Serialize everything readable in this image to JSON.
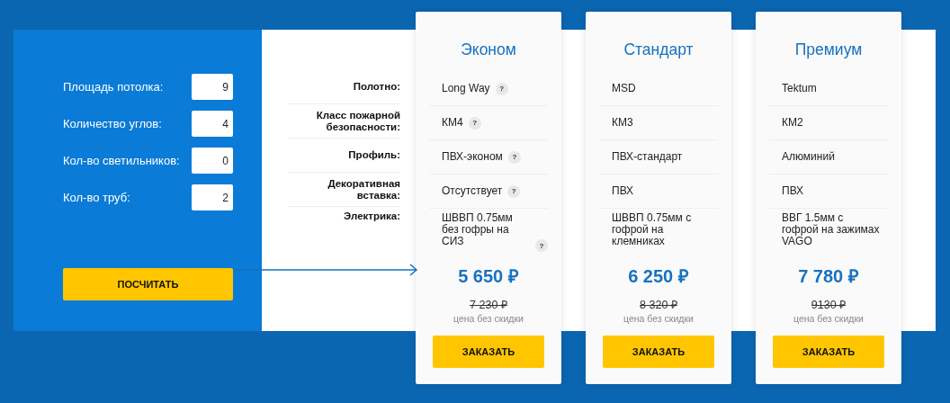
{
  "calculator": {
    "fields": [
      {
        "label": "Площадь потолка:",
        "value": "9"
      },
      {
        "label": "Количество углов:",
        "value": "4"
      },
      {
        "label": "Кол-во светильников:",
        "value": "0"
      },
      {
        "label": "Кол-во труб:",
        "value": "2"
      }
    ],
    "button": "ПОСЧИТАТЬ"
  },
  "comparison": {
    "row_labels": [
      "Полотно:",
      "Класс пожарной безопасности:",
      "Профиль:",
      "Декоративная вставка:",
      "Электрика:"
    ],
    "plans": [
      {
        "name": "Эконом",
        "features": [
          {
            "text": "Long Way",
            "help": "?"
          },
          {
            "text": "КМ4",
            "help": "?"
          },
          {
            "text": "ПВХ-эконом",
            "help": "?"
          },
          {
            "text": "Отсутствует",
            "help": "?"
          },
          {
            "text": "ШВВП 0.75мм без гофры на СИЗ",
            "help": "?"
          }
        ],
        "price": "5 650 ₽",
        "old_price": "7 230 ₽",
        "price_note": "цена без скидки",
        "button": "ЗАКАЗАТЬ"
      },
      {
        "name": "Стандарт",
        "features": [
          {
            "text": "MSD"
          },
          {
            "text": "КМ3"
          },
          {
            "text": "ПВХ-стандарт"
          },
          {
            "text": "ПВХ"
          },
          {
            "text": "ШВВП 0.75мм с гофрой на клемниках"
          }
        ],
        "price": "6 250 ₽",
        "old_price": "8 320 ₽",
        "price_note": "цена без скидки",
        "button": "ЗАКАЗАТЬ"
      },
      {
        "name": "Премиум",
        "features": [
          {
            "text": "Tektum"
          },
          {
            "text": "КМ2"
          },
          {
            "text": "Алюминий"
          },
          {
            "text": "ПВХ"
          },
          {
            "text": "ВВГ 1.5мм с гофрой на зажимах VAGO"
          }
        ],
        "price": "7 780 ₽",
        "old_price": "9130 ₽",
        "price_note": "цена без скидки",
        "button": "ЗАКАЗАТЬ"
      }
    ]
  }
}
